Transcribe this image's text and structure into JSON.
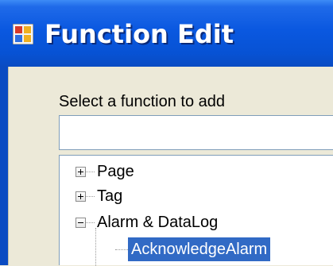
{
  "window": {
    "title": "Function Edit"
  },
  "dialog": {
    "prompt_label": "Select a function to add",
    "function_input_value": ""
  },
  "tree": {
    "nodes": [
      {
        "label": "Page",
        "state": "collapsed"
      },
      {
        "label": "Tag",
        "state": "collapsed"
      },
      {
        "label": "Alarm & DataLog",
        "state": "expanded"
      },
      {
        "label": "AcknowledgeAlarm",
        "state": "selected"
      }
    ]
  },
  "colors": {
    "titlebar": "#0a58e0",
    "selection": "#316ac5",
    "dialog_bg": "#ece9d8"
  }
}
